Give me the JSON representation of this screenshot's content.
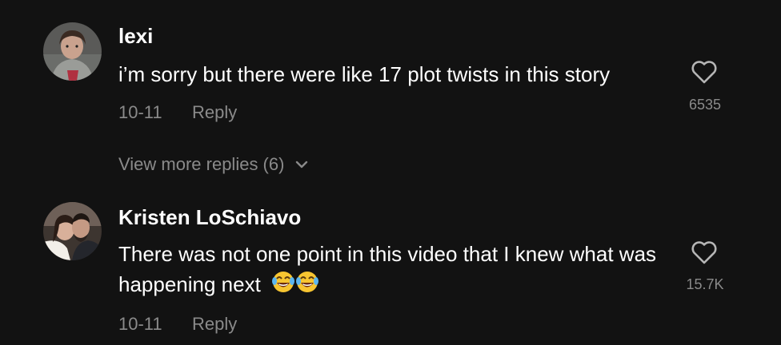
{
  "comments": [
    {
      "username": "lexi",
      "text": "i’m sorry but there were like 17 plot twists in this story",
      "date": "10-11",
      "reply_label": "Reply",
      "like_count": "6535",
      "avatar_icon": "user-avatar-photo",
      "like_icon": "heart-outline-icon"
    },
    {
      "username": "Kristen LoSchiavo",
      "text": "There was not one point in this video that I knew what was happening next",
      "emoji": "😂😂",
      "date": "10-11",
      "reply_label": "Reply",
      "like_count": "15.7K",
      "avatar_icon": "user-avatar-photo",
      "like_icon": "heart-outline-icon"
    }
  ],
  "view_more": {
    "label": "View more replies (6)",
    "icon": "chevron-down-icon"
  },
  "colors": {
    "background": "#121212",
    "primary_text": "#ffffff",
    "secondary_text": "#8a8a8a"
  }
}
